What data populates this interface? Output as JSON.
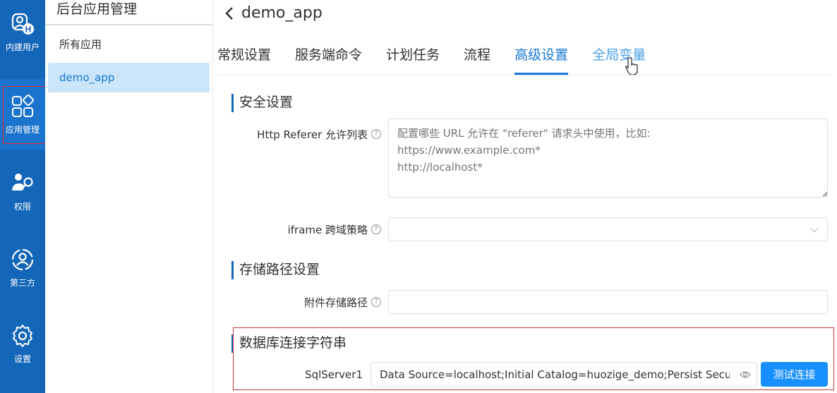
{
  "rail": {
    "items": [
      {
        "label": "内建用户",
        "icon": "builtin-user-icon"
      },
      {
        "label": "应用管理",
        "icon": "app-grid-icon"
      },
      {
        "label": "权限",
        "icon": "permission-key-icon"
      },
      {
        "label": "第三方",
        "icon": "third-party-icon"
      },
      {
        "label": "设置",
        "icon": "gear-icon"
      }
    ]
  },
  "panel": {
    "title": "后台应用管理",
    "items": [
      {
        "label": "所有应用"
      },
      {
        "label": "demo_app"
      }
    ]
  },
  "main": {
    "back_title": "demo_app",
    "tabs": [
      {
        "label": "常规设置"
      },
      {
        "label": "服务端命令"
      },
      {
        "label": "计划任务"
      },
      {
        "label": "流程"
      },
      {
        "label": "高级设置"
      },
      {
        "label": "全局变量"
      }
    ],
    "sections": {
      "security": {
        "title": "安全设置",
        "referer_label": "Http Referer 允许列表",
        "referer_placeholder": "配置哪些 URL 允许在 \"referer\" 请求头中使用，比如:\nhttps://www.example.com*\nhttp://localhost*",
        "iframe_label": "iframe 跨域策略"
      },
      "storage": {
        "title": "存储路径设置",
        "path_label": "附件存储路径"
      },
      "database": {
        "title": "数据库连接字符串",
        "sqlserver_label": "SqlServer1",
        "sqlserver_value": "Data Source=localhost;Initial Catalog=huozige_demo;Persist Security",
        "test_button": "测试连接"
      }
    }
  },
  "colors": {
    "rail_bg": "#1466b8",
    "accent": "#1677d2",
    "button": "#1890ff",
    "highlight_box": "#e0262d"
  }
}
